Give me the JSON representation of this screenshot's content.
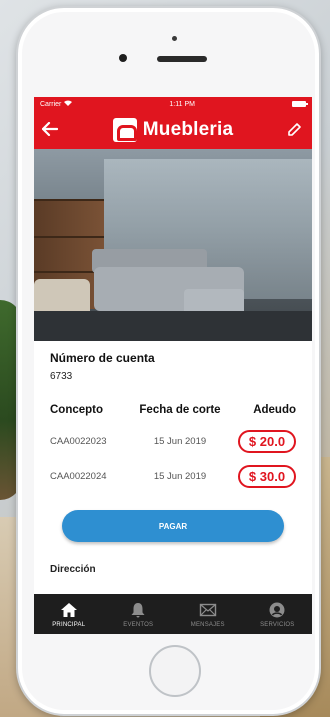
{
  "status_bar": {
    "carrier": "Carrier",
    "time": "1:11 PM"
  },
  "header": {
    "title": "Muebleria",
    "back_icon": "arrow-left-icon",
    "edit_icon": "pencil-icon"
  },
  "account": {
    "label": "Número de cuenta",
    "value": "6733"
  },
  "table": {
    "headers": [
      "Concepto",
      "Fecha de corte",
      "Adeudo"
    ],
    "rows": [
      {
        "concept": "CAA0022023",
        "date": "15 Jun 2019",
        "amount": "$ 20.0"
      },
      {
        "concept": "CAA0022024",
        "date": "15 Jun 2019",
        "amount": "$ 30.0"
      }
    ]
  },
  "pay_button": {
    "label": "PAGAR"
  },
  "partial_text": "Dirección",
  "tabs": [
    {
      "label": "PRINCIPAL",
      "icon": "home-icon",
      "active": true
    },
    {
      "label": "EVENTOS",
      "icon": "bell-icon",
      "active": false
    },
    {
      "label": "MENSAJES",
      "icon": "envelope-icon",
      "active": false
    },
    {
      "label": "SERVICIOS",
      "icon": "services-icon",
      "active": false
    }
  ],
  "colors": {
    "brand_red": "#e0151f",
    "pay_blue": "#2e8fd1",
    "tab_bar": "#1e1e1e"
  }
}
